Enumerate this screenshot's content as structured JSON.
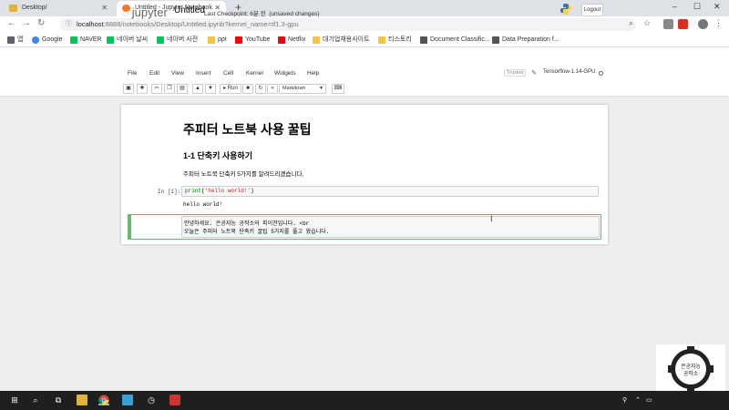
{
  "browser": {
    "tabs": [
      {
        "label": "Desktop/",
        "active": false
      },
      {
        "label": "Untitled - Jupyter Notebook",
        "active": true
      }
    ],
    "new_tab": "+",
    "window_controls": [
      "–",
      "☐",
      "✕"
    ],
    "url_host": "localhost",
    "url_rest": ":8888/notebooks/Desktop/Untitled.ipynb?kernel_name=tf1.3-gpu",
    "bookmarks": [
      {
        "label": "앱",
        "color": "#5f6368"
      },
      {
        "label": "Google",
        "color": "#4285f4"
      },
      {
        "label": "NAVER",
        "color": "#03c75a"
      },
      {
        "label": "네이버 날씨",
        "color": "#03c75a"
      },
      {
        "label": "네이버 사전",
        "color": "#03c75a"
      },
      {
        "label": "ppt",
        "color": "#f4c542"
      },
      {
        "label": "YouTube",
        "color": "#ff0000"
      },
      {
        "label": "Netflix",
        "color": "#e50914"
      },
      {
        "label": "대기업채용사이트",
        "color": "#f4c542"
      },
      {
        "label": "티스토리",
        "color": "#f4c542"
      },
      {
        "label": "Document Classific...",
        "color": "#555555"
      },
      {
        "label": "Data Preparation f...",
        "color": "#555555"
      }
    ]
  },
  "jupyter": {
    "logo_text": "jupyter",
    "notebook_name": "Untitled",
    "checkpoint": "Last Checkpoint: 6분 전",
    "unsaved": "(unsaved changes)",
    "logout_label": "Logout",
    "menu": [
      "File",
      "Edit",
      "View",
      "Insert",
      "Cell",
      "Kernel",
      "Widgets",
      "Help"
    ],
    "trusted_label": "Trusted",
    "kernel_name": "Tensorflow-1.14-GPU",
    "run_label": "Run",
    "cell_type": "Markdown"
  },
  "notebook": {
    "heading1": "주피터 노트북 사용 꿀팁",
    "heading2": "1-1 단축키 사용하기",
    "paragraph": "주피터 노트북 단축키 5가지를 알려드리겠습니다.",
    "code_prompt": "In [1]:",
    "code_fn": "print",
    "code_str": "'hello world!'",
    "output": "hello world!",
    "edit_line1": "안녕하세요. 은공지능 공작소의 피이찬입니다. <br",
    "edit_line2": "오늘은 주피터 노트북 단축키 꿀팁 5가지를 풀고 왔습니다."
  },
  "watermark": {
    "line1": "은공지능",
    "line2": "공작소"
  },
  "colors": {
    "jupyter_orange": "#f37726",
    "edit_green": "#66bb6a",
    "prompt_blue": "#303f9f",
    "taskbar": "#1f1f1f"
  }
}
